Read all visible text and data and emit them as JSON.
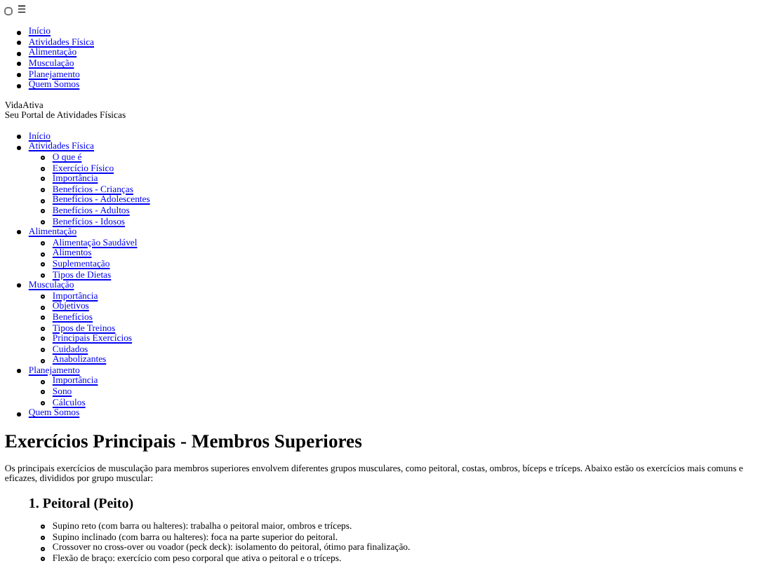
{
  "menu_toggle": {
    "checked": false,
    "icon": "☰"
  },
  "top_nav": [
    "Início",
    "Atividades Física",
    "Alimentação",
    "Musculação",
    "Planejamento",
    "Quem Somos"
  ],
  "brand": {
    "name": "VidaAtiva",
    "tagline": "Seu Portal de Atividades Físicas"
  },
  "nav": [
    {
      "label": "Início"
    },
    {
      "label": "Atividades Física",
      "children": [
        "O que é",
        "Exercício Físico",
        "Importância",
        "Benefícios - Crianças",
        "Benefícios - Adolescentes",
        "Benefícios - Adultos",
        "Benefícios - Idosos"
      ]
    },
    {
      "label": "Alimentação",
      "children": [
        "Alimentação Saudável",
        "Alimentos",
        "Suplementação",
        "Tipos de Dietas"
      ]
    },
    {
      "label": "Musculação",
      "children": [
        "Importância",
        "Objetivos",
        "Benefícios",
        "Tipos de Treinos",
        "Principais Exercícios",
        "Cuidados",
        "Anabolizantes"
      ]
    },
    {
      "label": "Planejamento",
      "children": [
        "Importância",
        "Sono",
        "Cálculos"
      ]
    },
    {
      "label": "Quem Somos"
    }
  ],
  "article": {
    "title": "Exercícios Principais - Membros Superiores",
    "intro": "Os principais exercícios de musculação para membros superiores envolvem diferentes grupos musculares, como peitoral, costas, ombros, bíceps e tríceps. Abaixo estão os exercícios mais comuns e eficazes, divididos por grupo muscular:",
    "sections": [
      {
        "heading": "1. Peitoral (Peito)",
        "items": [
          "Supino reto (com barra ou halteres): trabalha o peitoral maior, ombros e tríceps.",
          "Supino inclinado (com barra ou halteres): foca na parte superior do peitoral.",
          "Crossover no cross-over ou voador (peck deck): isolamento do peitoral, ótimo para finalização.",
          "Flexão de braço: exercício com peso corporal que ativa o peitoral e o tríceps."
        ]
      }
    ]
  }
}
